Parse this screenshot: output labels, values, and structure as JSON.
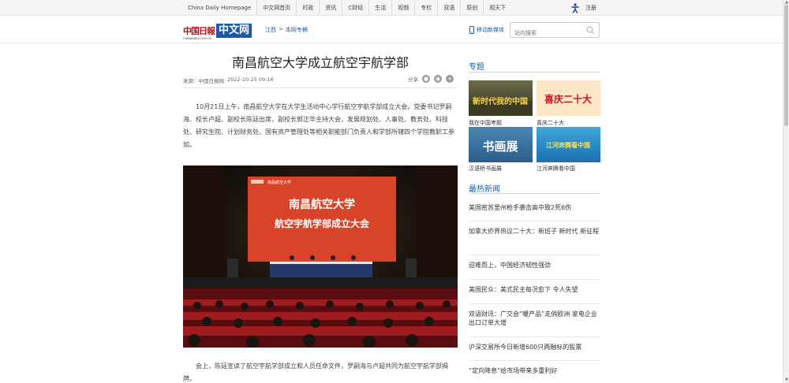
{
  "topbar": {
    "nav": [
      "China Daily Homepage",
      "中文网首页",
      "时政",
      "资讯",
      "C财经",
      "生活",
      "视频",
      "专栏",
      "双语",
      "原创",
      "观天下"
    ],
    "register": "注册"
  },
  "header": {
    "logo_cn": "中国日報",
    "logo_sub": "CHINADAILY.COM.CN",
    "logo_box": "中文网",
    "breadcrumb": [
      "江西",
      ">",
      "本网专稿"
    ],
    "mobile": "移动新媒体",
    "search_placeholder": "站内搜索"
  },
  "article": {
    "title": "南昌航空大学成立航空宇航学部",
    "source": "来源：中国日报网",
    "time": "2022-10-25 09:16",
    "share_label": "分享",
    "paragraph1": "10月21日上午，南昌航空大学在大学生活动中心学行航空宇航学部成立大会。党委书记罗嗣海、校长卢超、副校长陈廷出席，副校长郭正华主持大会，发展规划处、人事处、教务处、科技处、研究生院、计划财务处、国有资产管理处等相关职能部门负责人和学部所辖四个学院教职工参加。",
    "photo_line1": "南昌航空大学",
    "photo_line2": "航空宇航学部成立大会",
    "photo_school": "南昌航空大学",
    "paragraph2": "会上，陈廷宣读了航空宇航学部成立和人员任命文件，罗嗣海与卢超共同为航空宇航学部揭牌。"
  },
  "sidebar": {
    "topics_title": "专题",
    "topics": [
      {
        "caption": "我在中国考题",
        "banner": "新时代我的中国"
      },
      {
        "caption": "喜庆二十大",
        "banner": "喜庆二十大"
      },
      {
        "caption": "汉语桥书画展",
        "banner": "书画展"
      },
      {
        "caption": "江河奔腾看中国",
        "banner": "江河奔腾看中国"
      }
    ],
    "hot_title": "最热新闻",
    "hot": [
      "美国密苏里州枪手袭击高中致2死6伤",
      "加拿大侨界热议二十大：新班子 新时代 新征程",
      "迎难而上，中国经济韧性强劲",
      "美国民众：美式民主每况愈下 令人失望",
      "双语财讯：广交会“暖产品”走俏欧洲 家电企业出口订单大增",
      "沪深交易所今日新增600只两融标的股票",
      "“定向降息”给市场带来多重利好"
    ]
  },
  "colors": {
    "brand_red": "#b5121b",
    "link_blue": "#1d5ca8",
    "stage_red": "#d8442a"
  },
  "icons": [
    "accessibility-icon",
    "phone-icon",
    "search-icon",
    "wechat-icon",
    "weibo-icon",
    "plus-icon"
  ]
}
